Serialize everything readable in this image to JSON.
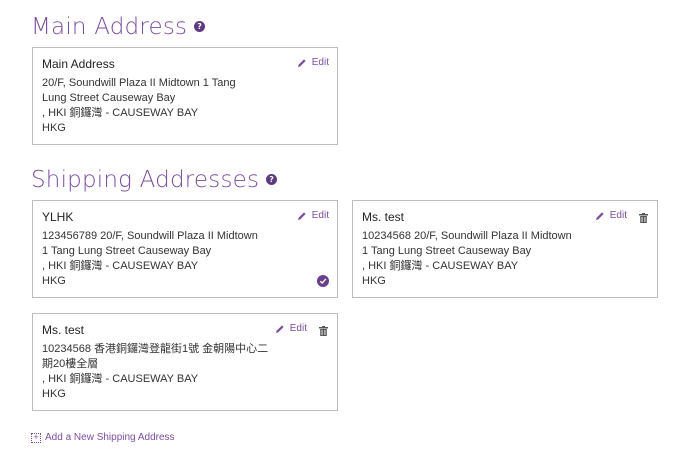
{
  "main_section": {
    "title": "Main Address",
    "help": "?"
  },
  "main_card": {
    "name": "Main Address",
    "edit_label": "Edit",
    "lines": [
      "20/F, Soundwill Plaza II Midtown 1 Tang",
      "Lung Street Causeway Bay",
      ", HKI 銅鑼灣 - CAUSEWAY BAY",
      "HKG"
    ]
  },
  "shipping_section": {
    "title": "Shipping Addresses",
    "help": "?"
  },
  "shipping_cards": [
    {
      "name": "YLHK",
      "edit_label": "Edit",
      "lines": [
        "123456789 20/F, Soundwill Plaza II Midtown",
        "1 Tang Lung Street Causeway Bay",
        ", HKI 銅鑼灣 - CAUSEWAY BAY",
        "HKG"
      ],
      "is_default": true
    },
    {
      "name": "Ms. test",
      "edit_label": "Edit",
      "lines": [
        "10234568 20/F, Soundwill Plaza II Midtown",
        "1 Tang Lung Street Causeway Bay",
        ", HKI 銅鑼灣 - CAUSEWAY BAY",
        "HKG"
      ],
      "is_default": false
    },
    {
      "name": "Ms. test",
      "edit_label": "Edit",
      "lines": [
        "10234568 香港銅鑼灣登龍街1號 金朝陽中心二",
        "期20樓全層",
        ", HKI 銅鑼灣 - CAUSEWAY BAY",
        "HKG"
      ],
      "is_default": false
    }
  ],
  "add_link": {
    "label": "Add a New Shipping Address",
    "icon": "plus-box-icon"
  },
  "colors": {
    "accent": "#7b4f9e",
    "badge": "#6a3f8f",
    "border": "#bdbdbd"
  }
}
